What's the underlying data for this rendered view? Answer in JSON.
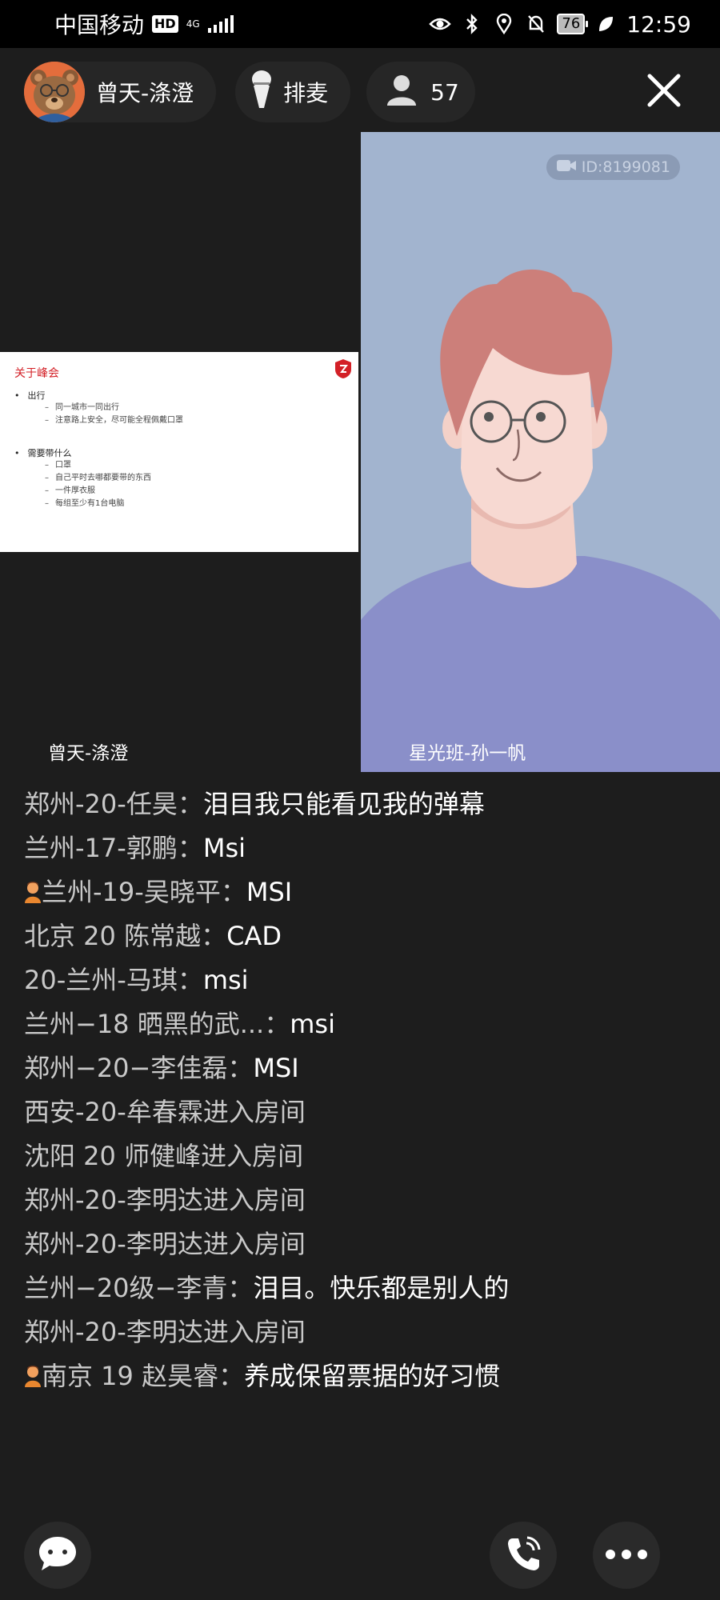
{
  "status_bar": {
    "carrier": "中国移动",
    "hd": "HD",
    "network": "4G",
    "battery": "76",
    "time": "12:59"
  },
  "top_bar": {
    "host_name": "曾天-涤澄",
    "mic_label": "排麦",
    "viewer_count": "57"
  },
  "stage": {
    "host_caption": "曾天-涤澄",
    "guest_caption": "星光班-孙一帆",
    "video_id": "ID:8199081",
    "slide": {
      "title": "关于峰会",
      "bullet1": "出行",
      "bullet1_sub1": "同一城市一同出行",
      "bullet1_sub2": "注意路上安全，尽可能全程佩戴口罩",
      "bullet2": "需要带什么",
      "bullet2_sub1": "口罩",
      "bullet2_sub2": "自己平时去哪都要带的东西",
      "bullet2_sub3": "一件厚衣服",
      "bullet2_sub4": "每组至少有1台电脑"
    }
  },
  "chat": [
    {
      "nick": "郑州-20-任昊：",
      "text": "泪目我只能看见我的弹幕",
      "emoji": false
    },
    {
      "nick": "兰州-17-郭鹏：",
      "text": "Msi",
      "emoji": false
    },
    {
      "nick": "兰州-19-吴晓平：",
      "text": "MSI",
      "emoji": true
    },
    {
      "nick": "北京 20 陈常越：",
      "text": "CAD",
      "emoji": false
    },
    {
      "nick": "20-兰州-马琪：",
      "text": "msi",
      "emoji": false
    },
    {
      "nick": "兰州−18 晒黑的武...：",
      "text": "msi",
      "emoji": false
    },
    {
      "nick": "郑州−20−李佳磊：",
      "text": "MSI",
      "emoji": false
    },
    {
      "nick": "西安-20-牟春霖进入房间",
      "text": "",
      "emoji": false
    },
    {
      "nick": "沈阳 20 师健峰进入房间",
      "text": "",
      "emoji": false
    },
    {
      "nick": "郑州-20-李明达进入房间",
      "text": "",
      "emoji": false
    },
    {
      "nick": "郑州-20-李明达进入房间",
      "text": "",
      "emoji": false
    },
    {
      "nick": "兰州−20级−李青：",
      "text": "泪目。快乐都是别人的",
      "emoji": false
    },
    {
      "nick": "郑州-20-李明达进入房间",
      "text": "",
      "emoji": false
    },
    {
      "nick": "南京 19 赵昊睿：",
      "text": "养成保留票据的好习惯",
      "emoji": true
    }
  ],
  "colors": {
    "background": "#1d1d1d",
    "nick": "#c9c9c9",
    "slide_accent": "#d32027",
    "video_bg": "#a2b4cf"
  }
}
